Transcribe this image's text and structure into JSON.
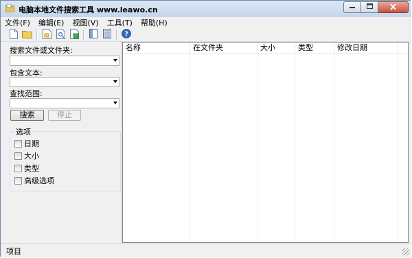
{
  "window": {
    "title": "电脑本地文件搜索工具  www.leawo.cn",
    "min_icon": "minimize-icon",
    "max_icon": "maximize-icon",
    "close_icon": "close-icon"
  },
  "menu": [
    {
      "label": "文件(F)"
    },
    {
      "label": "编辑(E)"
    },
    {
      "label": "视图(V)"
    },
    {
      "label": "工具(T)"
    },
    {
      "label": "帮助(H)"
    }
  ],
  "toolbar": {
    "icons": [
      "new-file-icon",
      "open-folder-icon",
      "copy-file-icon",
      "find-file-icon",
      "export-file-icon",
      "pane-icon",
      "details-view-icon",
      "help-icon"
    ]
  },
  "search": {
    "name_label": "搜索文件或文件夹:",
    "name_value": "",
    "content_label": "包含文本:",
    "content_value": "",
    "scope_label": "查找范围:",
    "scope_value": "",
    "search_button": "搜索",
    "stop_button": "停止"
  },
  "options": {
    "title": "选项",
    "items": [
      {
        "label": "日期",
        "checked": false
      },
      {
        "label": "大小",
        "checked": false
      },
      {
        "label": "类型",
        "checked": false
      },
      {
        "label": "高级选项",
        "checked": false
      }
    ]
  },
  "results": {
    "columns": [
      {
        "label": "名称"
      },
      {
        "label": "在文件夹"
      },
      {
        "label": "大小"
      },
      {
        "label": "类型"
      },
      {
        "label": "修改日期"
      }
    ],
    "rows": []
  },
  "status": {
    "text": "项目"
  },
  "colors": {
    "title_bg": "#cfdbe9",
    "close_button": "#c75040",
    "pane_bg": "#f0f0f0"
  }
}
